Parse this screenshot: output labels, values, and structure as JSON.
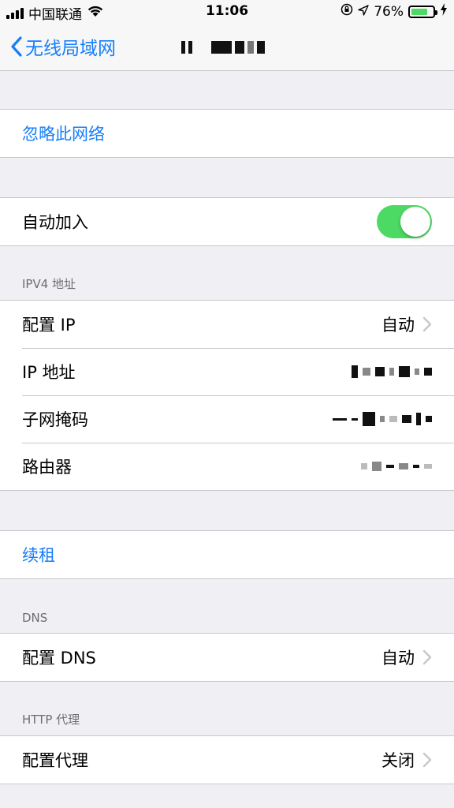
{
  "status_bar": {
    "carrier": "中国联通",
    "time": "11:06",
    "battery_percent": "76%",
    "battery_level": 0.76
  },
  "nav": {
    "back_label": "无线局域网"
  },
  "forget_network": "忽略此网络",
  "auto_join": {
    "label": "自动加入",
    "enabled": true
  },
  "ipv4": {
    "header": "IPV4 地址",
    "rows": [
      {
        "label": "配置 IP",
        "value": "自动"
      },
      {
        "label": "IP 地址"
      },
      {
        "label": "子网掩码"
      },
      {
        "label": "路由器"
      }
    ]
  },
  "renew_lease": "续租",
  "dns": {
    "header": "DNS",
    "configure_label": "配置 DNS",
    "configure_value": "自动"
  },
  "http_proxy": {
    "header": "HTTP 代理",
    "configure_label": "配置代理",
    "configure_value": "关闭"
  },
  "colors": {
    "accent": "#157efb",
    "toggle_on": "#4cd964",
    "background": "#efeff4",
    "separator": "#c8c7cc",
    "section_header": "#6d6d72"
  }
}
